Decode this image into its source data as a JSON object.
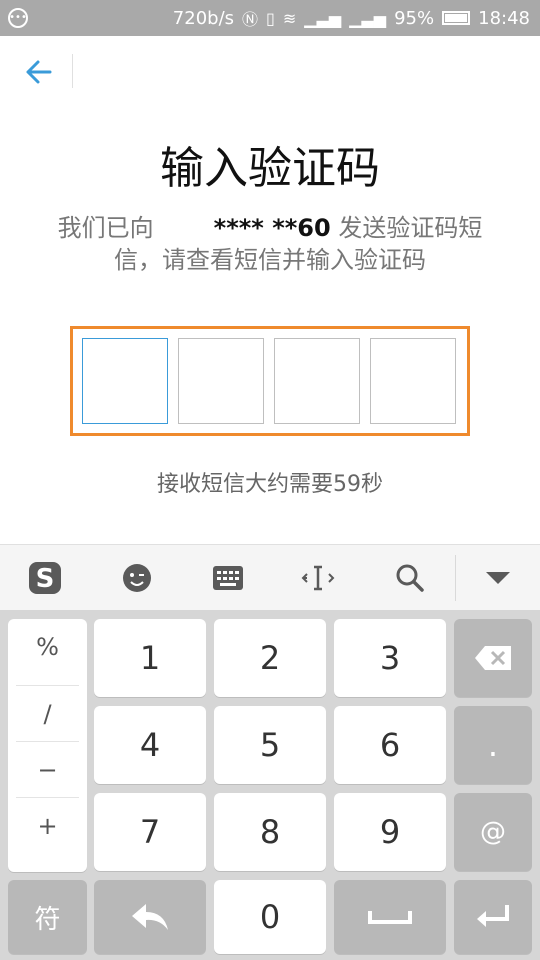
{
  "status_bar": {
    "speed": "720b/s",
    "battery_percent": "95%",
    "time": "18:48"
  },
  "header": {
    "back_icon": "arrow-left-icon"
  },
  "main": {
    "title": "输入验证码",
    "desc_prefix": "我们已向",
    "masked_number": "**** **60",
    "desc_suffix": "发送验证码短信，请查看短信并输入验证码",
    "code_digits": [
      "",
      "",
      "",
      ""
    ],
    "timer_text": "接收短信大约需要59秒"
  },
  "keyboard_toolbar": {
    "items": [
      "sogou-logo-icon",
      "emoji-icon",
      "keyboard-icon",
      "cursor-move-icon",
      "search-icon",
      "collapse-keyboard-icon"
    ]
  },
  "keyboard": {
    "symbols": [
      "%",
      "/",
      "−",
      "+"
    ],
    "digits": [
      "1",
      "2",
      "3",
      "4",
      "5",
      "6",
      "7",
      "8",
      "9",
      "0"
    ],
    "dot": ".",
    "at": "@",
    "fu": "符"
  },
  "colors": {
    "accent_blue": "#3a9bd9",
    "highlight_orange": "#ef8a2d",
    "status_bar_bg": "#a9a9a9",
    "keyboard_bg": "#d6d6d6",
    "dark_key": "#b8b8b8"
  }
}
